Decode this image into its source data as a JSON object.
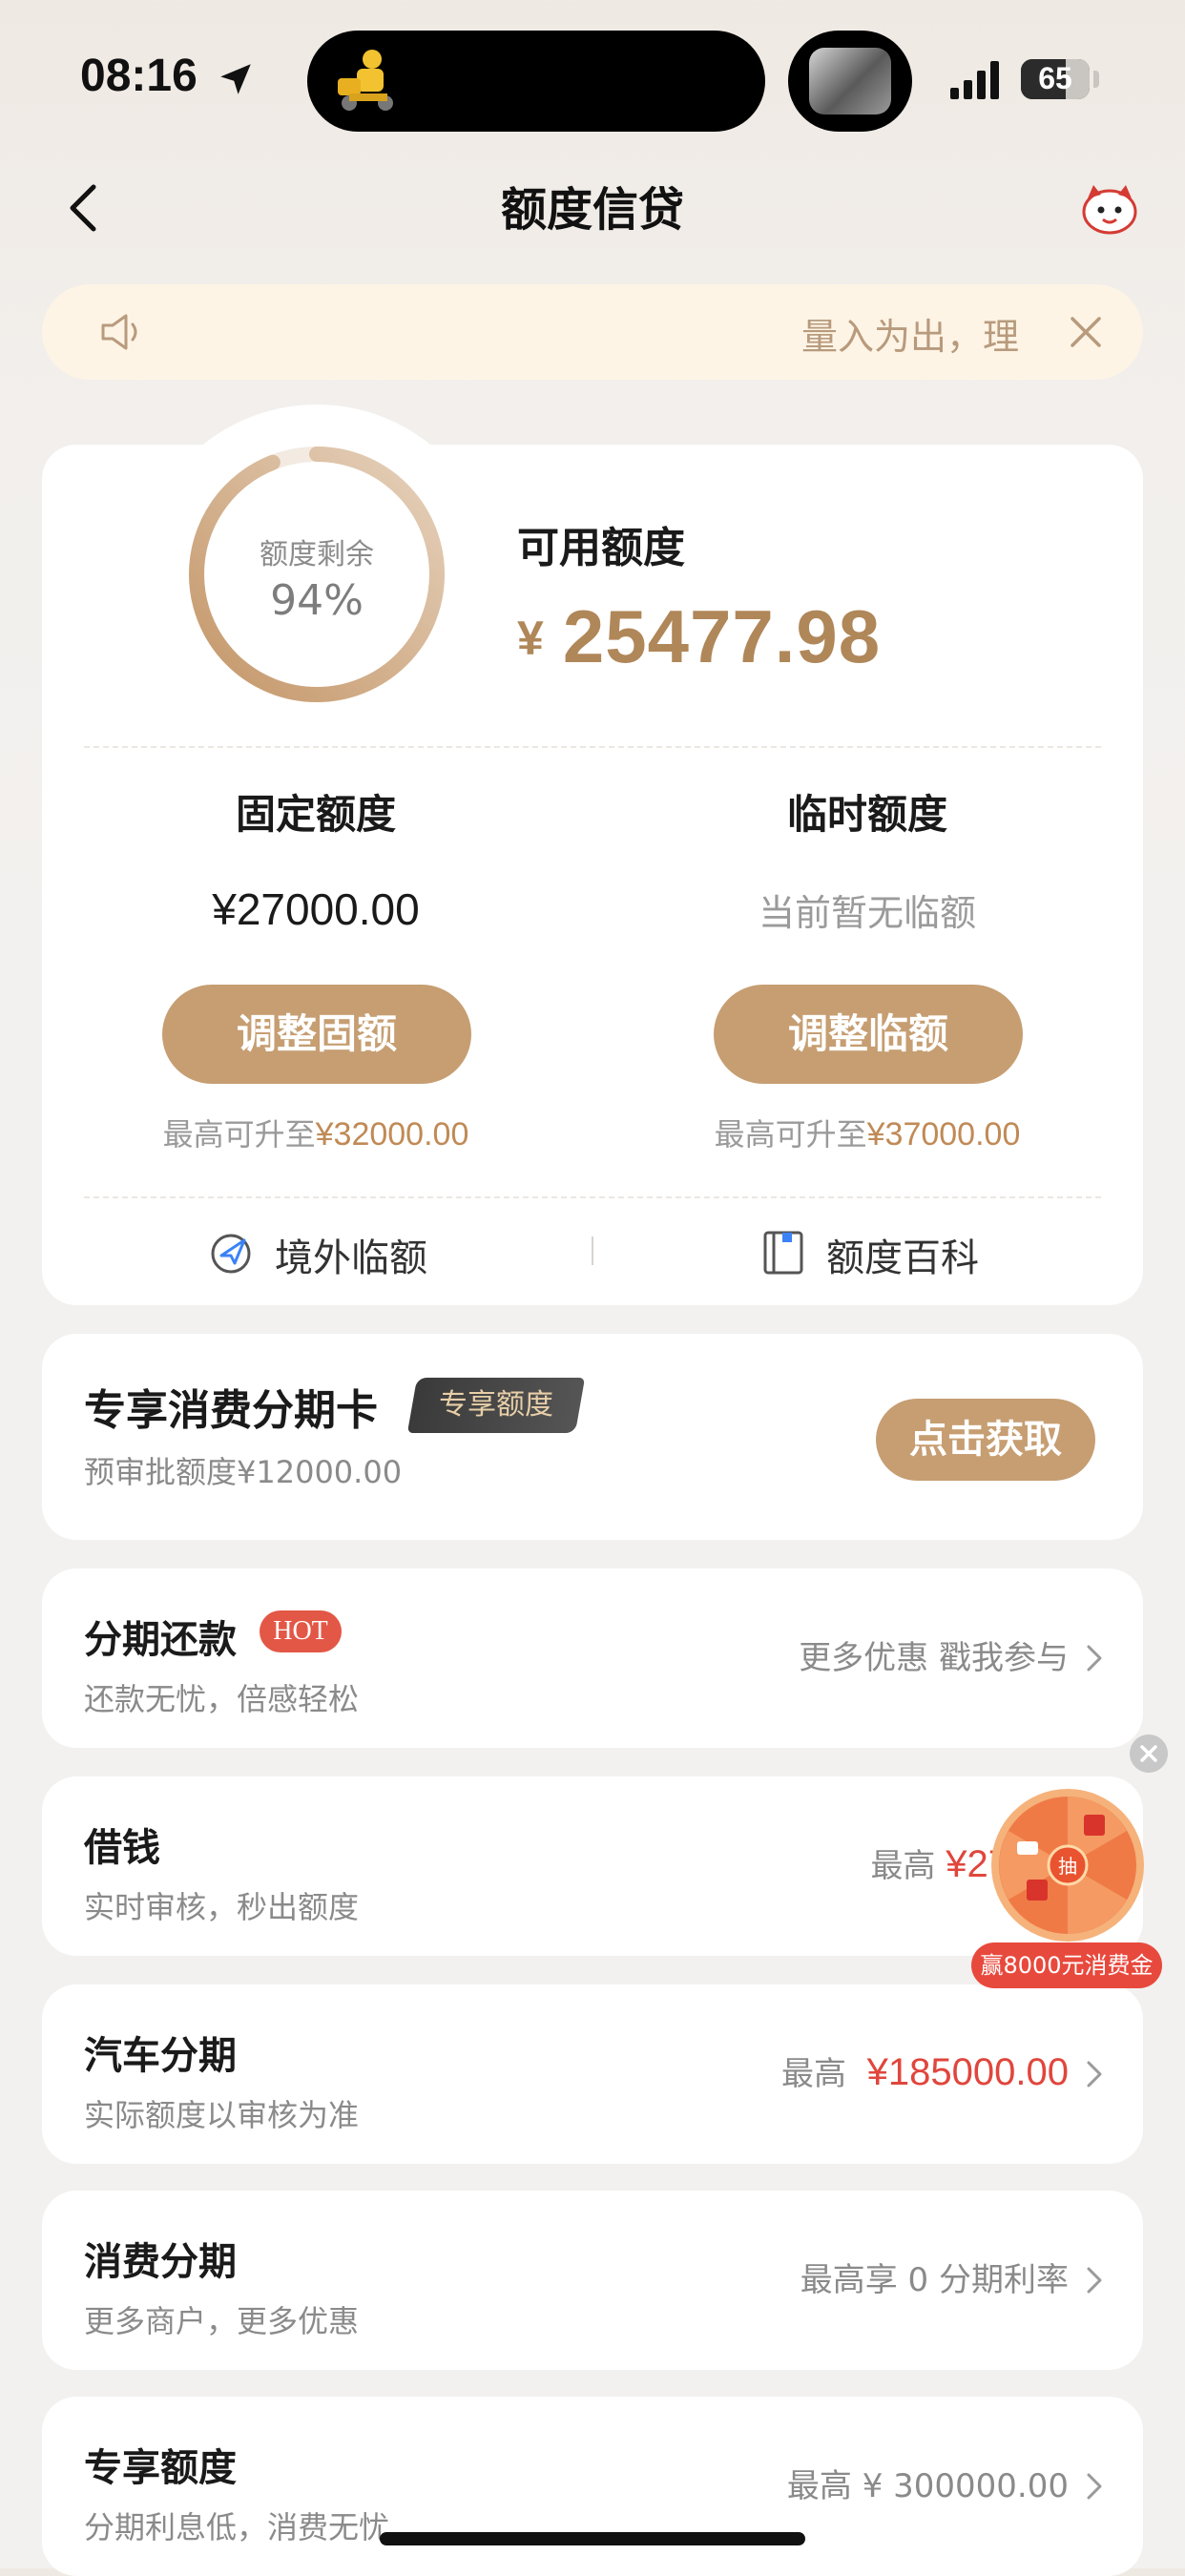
{
  "status_bar": {
    "time": "08:16",
    "battery": "65",
    "battery_level": 0.65
  },
  "nav": {
    "title": "额度信贷"
  },
  "notice": {
    "text": "量入为出，理"
  },
  "credit": {
    "ring_label": "额度剩余",
    "ring_value": "94%",
    "ring_fraction": 0.94,
    "available_label": "可用额度",
    "available_symbol": "¥",
    "available_value": "25477.98",
    "fixed": {
      "title": "固定额度",
      "value": "¥27000.00",
      "button": "调整固额",
      "max_prefix": "最高可升至",
      "max_amount": "¥32000.00"
    },
    "temp": {
      "title": "临时额度",
      "value": "当前暂无临额",
      "button": "调整临额",
      "max_prefix": "最高可升至",
      "max_amount": "¥37000.00"
    },
    "links": {
      "overseas": "境外临额",
      "wiki": "额度百科"
    }
  },
  "exclusive": {
    "title": "专享消费分期卡",
    "badge": "专享额度",
    "subtitle": "预审批额度¥12000.00",
    "button": "点击获取"
  },
  "list": [
    {
      "title": "分期还款",
      "badge": "HOT",
      "subtitle": "还款无忧，倍感轻松",
      "right_text": "更多优惠 戳我参与",
      "right_amount": ""
    },
    {
      "title": "借钱",
      "badge": "",
      "subtitle": "实时审核，秒出额度",
      "right_text": "最高",
      "right_amount": "¥27"
    },
    {
      "title": "汽车分期",
      "badge": "",
      "subtitle": "实际额度以审核为准",
      "right_text": "最高",
      "right_amount": "¥185000.00"
    },
    {
      "title": "消费分期",
      "badge": "",
      "subtitle": "更多商户，更多优惠",
      "right_text": "最高享 0 分期利率",
      "right_amount": ""
    },
    {
      "title": "专享额度",
      "badge": "",
      "subtitle": "分期利息低，消费无忧",
      "right_text": "最高 ¥ 300000.00",
      "right_amount": ""
    }
  ],
  "promo": {
    "wheel_center": "抽",
    "banner": "赢8000元消费金"
  },
  "colors": {
    "accent": "#c69e72",
    "amount": "#b08759",
    "red": "#e0463c"
  }
}
